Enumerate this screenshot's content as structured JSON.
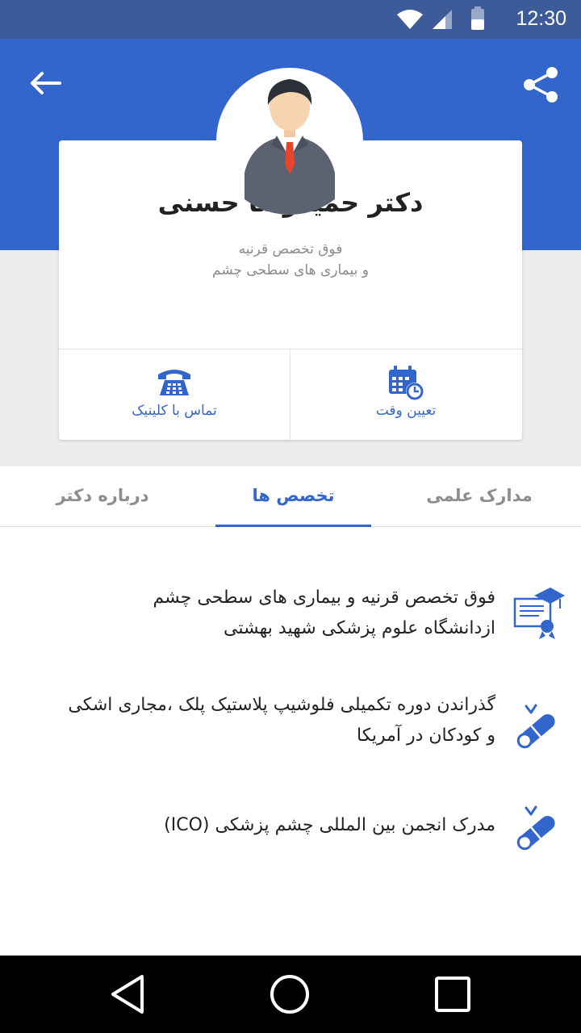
{
  "status_bar": {
    "time": "12:30",
    "icons": [
      "wifi-icon",
      "signal-icon",
      "battery-icon"
    ]
  },
  "header": {
    "back_icon": "arrow-left-icon",
    "share_icon": "share-icon"
  },
  "profile": {
    "name": "دکتر حمیدرضا حسنی",
    "specialty_line1": "فوق تخصص قرنیه",
    "specialty_line2": "و بیماری های سطحی چشم",
    "avatar_icon": "doctor-avatar-icon"
  },
  "actions": {
    "call_label": "تماس با کلینیک",
    "call_icon": "phone-icon",
    "appointment_label": "تعیین وقت",
    "appointment_icon": "calendar-clock-icon"
  },
  "tabs": {
    "credentials": "مدارک علمی",
    "specialties": "تخصص ها",
    "about": "درباره دکتر",
    "active": "specialties"
  },
  "specialties": [
    {
      "line1": "فوق تخصص قرنیه و بیماری های سطحی چشم",
      "line2": "ازدانشگاه علوم پزشکی شهید بهشتی",
      "icon": "graduation-certificate-icon"
    },
    {
      "line1": "گذراندن دوره تکمیلی فلوشیپ پلاستیک پلک ،مجاری اشکی",
      "line2": "و کودکان در آمریکا",
      "icon": "diploma-scroll-icon"
    },
    {
      "line1": "مدرک انجمن بین المللی چشم پزشکی (ICO)",
      "line2": "",
      "icon": "diploma-scroll-icon"
    }
  ],
  "nav_bar": {
    "back_icon": "nav-back-icon",
    "home_icon": "nav-home-icon",
    "recents_icon": "nav-recents-icon"
  },
  "colors": {
    "primary": "#3366cc",
    "status_bar": "#3d5a99",
    "background_gray": "#ececec",
    "text_dark": "#222222",
    "text_muted": "#8a8a8a"
  }
}
